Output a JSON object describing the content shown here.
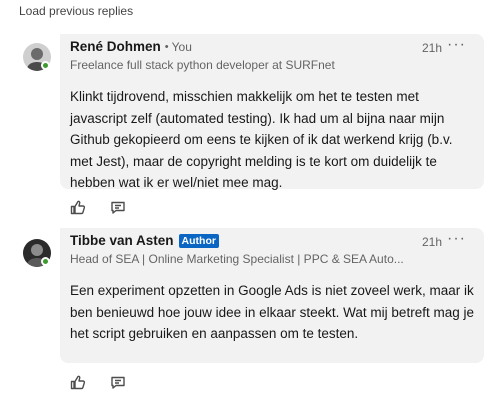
{
  "load_previous": "Load previous replies",
  "comments": [
    {
      "name": "René Dohmen",
      "you_label": "You",
      "headline": "Freelance full stack python developer at SURFnet",
      "time": "21h",
      "more_label": "···",
      "body": "Klinkt tijdrovend, misschien makkelijk om het te testen met javascript zelf (automated testing). Ik had um al bijna naar mijn Github gekopieerd om eens te kijken of ik dat werkend krijg (b.v. met Jest), maar de copyright melding is te kort om duidelijk te hebben wat ik er wel/niet mee mag."
    },
    {
      "name": "Tibbe van Asten",
      "badge": "Author",
      "headline": "Head of SEA | Online Marketing Specialist | PPC & SEA Auto...",
      "time": "21h",
      "more_label": "···",
      "body": "Een experiment opzetten in Google Ads is niet zoveel werk, maar ik ben benieuwd hoe jouw idee in elkaar steekt. Wat mij betreft mag je het script gebruiken en aanpassen om te testen."
    }
  ],
  "icons": {
    "like": "thumbs-up-icon",
    "reply": "comment-icon",
    "more": "ellipsis-icon"
  },
  "colors": {
    "bubble": "#f2f2f2",
    "author_badge": "#0a66c2",
    "presence": "#3d9a2f"
  }
}
